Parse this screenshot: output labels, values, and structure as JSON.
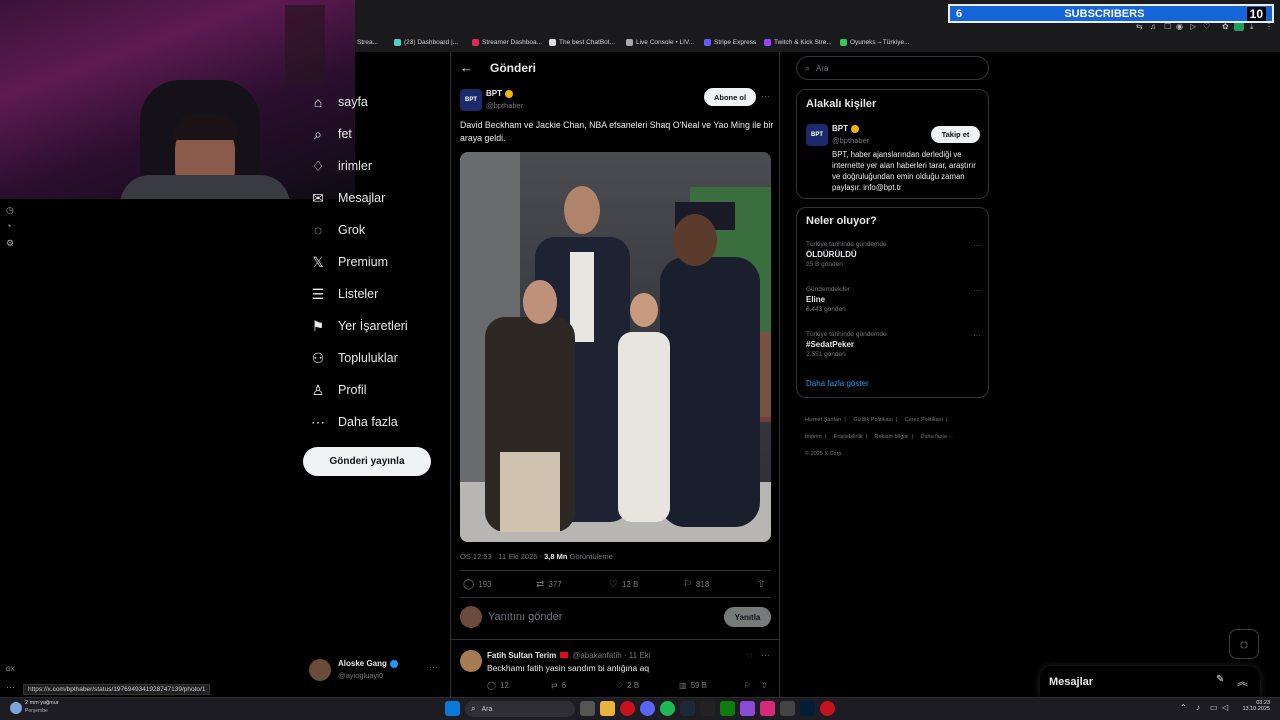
{
  "overlay": {
    "subscribers_count_left": "6",
    "subscribers_label": "SUBSCRIBERS",
    "subscribers_count_right": "10"
  },
  "bookmarks": [
    "ng Strea...",
    "(23) Dashboard |...",
    "Streamer Dashboa...",
    "The best ChatBot...",
    "Live Console • LIV...",
    "Stripe Express",
    "Twitch & Kick Stre...",
    "Oyuneks – Türkiye..."
  ],
  "nav": {
    "items": [
      {
        "label": "sayfa",
        "icon": "home-icon"
      },
      {
        "label": "fet",
        "icon": "explore-icon"
      },
      {
        "label": "irimler",
        "icon": "bell-icon"
      },
      {
        "label": "Mesajlar",
        "icon": "mail-icon"
      },
      {
        "label": "Grok",
        "icon": "grok-icon"
      },
      {
        "label": "Premium",
        "icon": "x-logo-icon"
      },
      {
        "label": "Listeler",
        "icon": "list-icon"
      },
      {
        "label": "Yer İşaretleri",
        "icon": "bookmark-icon"
      },
      {
        "label": "Topluluklar",
        "icon": "people-icon"
      },
      {
        "label": "Profil",
        "icon": "person-icon"
      },
      {
        "label": "Daha fazla",
        "icon": "more-circle-icon"
      }
    ],
    "post_button": "Gönderi yayınla"
  },
  "account": {
    "name": "Aloske Gang",
    "handle": "@ayiogluayi0"
  },
  "status_url": "https://x.com/bpthaber/status/1976949341928747139/photo/1",
  "header": {
    "title": "Gönderi"
  },
  "post": {
    "author_name": "BPT",
    "author_handle": "@bpthaber",
    "avatar_text": "BPT",
    "subscribe_label": "Abone ol",
    "text": "David Beckham ve Jackie Chan, NBA efsaneleri Shaq O'Neal ve Yao Ming ile bir araya geldi.",
    "time": "ÖS 12:53 · 11 Eki 2025 · ",
    "views": "3,8 Mn",
    "views_label": " Görüntüleme",
    "replies": "193",
    "reposts": "377",
    "likes": "12 B",
    "bookmarks": "818",
    "reply_placeholder": "Yanıtını gönder",
    "reply_button": "Yanıtla"
  },
  "comment": {
    "name": "Fatih Sultan Terim",
    "handle": "@abakanfatih · 11 Eki",
    "text": "Beckhamı fatih yasin sandım bi anlığına aq",
    "replies": "12",
    "reposts": "6",
    "likes": "2 B",
    "views": "59 B"
  },
  "search": {
    "placeholder": "Ara"
  },
  "related": {
    "title": "Alakalı kişiler",
    "name": "BPT",
    "handle": "@bpthaber",
    "follow_label": "Takip et",
    "bio": "BPT, haber ajanslarından derlediği ve internette yer alan haberleri tarar, araştırır ve doğruluğundan emin olduğu zaman paylaşır. info@bpt.tr"
  },
  "trends": {
    "title": "Neler oluyor?",
    "items": [
      {
        "category": "Türkiye tarihinde gündemde",
        "name": "ÖLDÜRÜLDÜ",
        "count": "25 B gönderi"
      },
      {
        "category": "Gündemdekiler",
        "name": "Eline",
        "count": "6.443 gönderi"
      },
      {
        "category": "Türkiye tarihinde gündemde",
        "name": "#SedatPeker",
        "count": "2.551 gönderi"
      }
    ],
    "show_more": "Daha fazla göster"
  },
  "footer": [
    "Hizmet Şartları",
    "Gizlilik Politikası",
    "Çerez Politikası",
    "Imprint",
    "Erişilebilirlik",
    "Reklam bilgisi",
    "Daha fazla ···",
    "© 2025 X Corp."
  ],
  "messages_drawer": {
    "title": "Mesajlar"
  },
  "taskbar": {
    "weather_temp": "2 mm yağmur",
    "weather_day": "Perşembe",
    "search_placeholder": "Ara",
    "time": "03:23",
    "date": "13.10.2025"
  },
  "colors": {
    "accent": "#1d9bf0",
    "verified": "#f4b400",
    "background": "#000000",
    "border": "#2f3336"
  }
}
